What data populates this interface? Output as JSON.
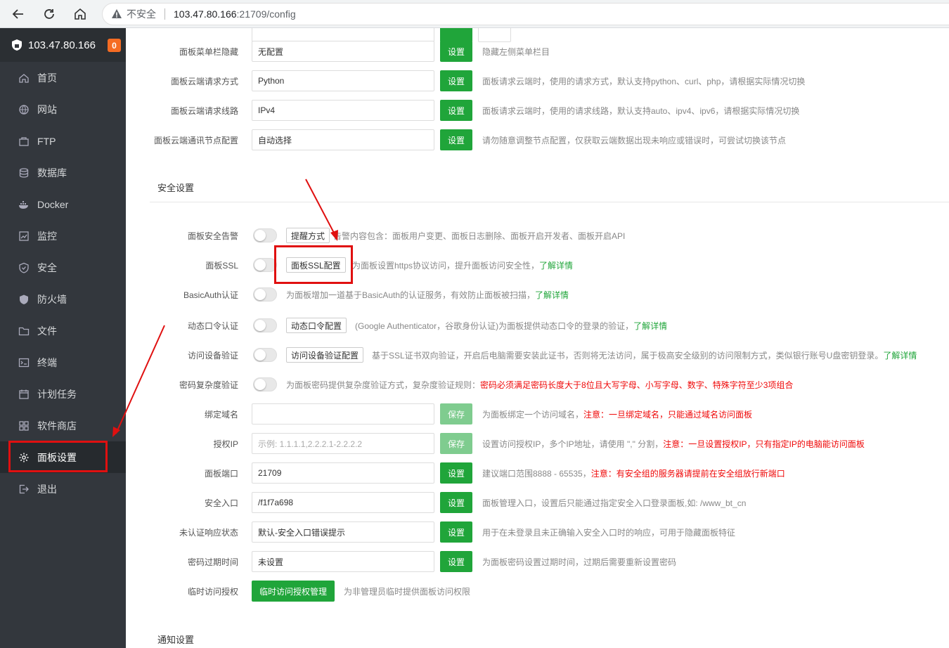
{
  "browser": {
    "security": "不安全",
    "url_host": "103.47.80.166",
    "url_path": ":21709/config"
  },
  "sidebar": {
    "server": "103.47.80.166",
    "badge": "0",
    "items": [
      {
        "label": "首页",
        "icon": "home-icon"
      },
      {
        "label": "网站",
        "icon": "globe-icon"
      },
      {
        "label": "FTP",
        "icon": "ftp-icon"
      },
      {
        "label": "数据库",
        "icon": "database-icon"
      },
      {
        "label": "Docker",
        "icon": "docker-icon"
      },
      {
        "label": "监控",
        "icon": "monitor-icon"
      },
      {
        "label": "安全",
        "icon": "shield-icon"
      },
      {
        "label": "防火墙",
        "icon": "firewall-icon"
      },
      {
        "label": "文件",
        "icon": "folder-icon"
      },
      {
        "label": "终端",
        "icon": "terminal-icon"
      },
      {
        "label": "计划任务",
        "icon": "calendar-icon"
      },
      {
        "label": "软件商店",
        "icon": "apps-icon"
      },
      {
        "label": "面板设置",
        "icon": "gear-icon"
      },
      {
        "label": "退出",
        "icon": "logout-icon"
      }
    ]
  },
  "panel": {
    "hide_menu": {
      "label": "面板菜单栏隐藏",
      "value": "无配置",
      "button": "设置",
      "hint": "隐藏左侧菜单栏目"
    },
    "cloud_method": {
      "label": "面板云端请求方式",
      "value": "Python",
      "button": "设置",
      "hint": "面板请求云端时，使用的请求方式，默认支持python、curl、php，请根据实际情况切换"
    },
    "cloud_line": {
      "label": "面板云端请求线路",
      "value": "IPv4",
      "button": "设置",
      "hint": "面板请求云端时，使用的请求线路，默认支持auto、ipv4、ipv6，请根据实际情况切换"
    },
    "cloud_node": {
      "label": "面板云端通讯节点配置",
      "value": "自动选择",
      "button": "设置",
      "hint": "请勿随意调整节点配置，仅获取云端数据出现未响应或错误时，可尝试切换该节点"
    }
  },
  "security": {
    "title": "安全设置",
    "alarm": {
      "label": "面板安全告警",
      "button": "提醒方式",
      "hint": "告警内容包含：面板用户变更、面板日志删除、面板开启开发者、面板开启API"
    },
    "ssl": {
      "label": "面板SSL",
      "button": "面板SSL配置",
      "hint": "为面板设置https协议访问，提升面板访问安全性，",
      "link": "了解详情"
    },
    "basicauth": {
      "label": "BasicAuth认证",
      "hint": "为面板增加一道基于BasicAuth的认证服务，有效防止面板被扫描，",
      "link": "了解详情"
    },
    "otp": {
      "label": "动态口令认证",
      "button": "动态口令配置",
      "hint": "(Google Authenticator，谷歌身份认证)为面板提供动态口令的登录的验证，",
      "link": "了解详情"
    },
    "device": {
      "label": "访问设备验证",
      "button": "访问设备验证配置",
      "hint": "基于SSL证书双向验证，开启后电脑需要安装此证书，否则将无法访问，属于极高安全级别的访问限制方式，类似银行账号U盘密钥登录。",
      "link": "了解详情"
    },
    "complexity": {
      "label": "密码复杂度验证",
      "hint": "为面板密码提供复杂度验证方式，复杂度验证规则：",
      "red": "密码必须满足密码长度大于8位且大写字母、小写字母、数字、特殊字符至少3项组合"
    },
    "domain": {
      "label": "绑定域名",
      "value": "",
      "button": "保存",
      "hint": "为面板绑定一个访问域名，",
      "red": "注意：一旦绑定域名，只能通过域名访问面板"
    },
    "auth_ip": {
      "label": "授权IP",
      "placeholder": "示例: 1.1.1.1,2.2.2.1-2.2.2.2",
      "button": "保存",
      "hint": "设置访问授权IP，多个IP地址，请使用 \",\" 分割，",
      "red": "注意：一旦设置授权IP，只有指定IP的电脑能访问面板"
    },
    "port": {
      "label": "面板端口",
      "value": "21709",
      "button": "设置",
      "hint": "建议端口范围8888 - 65535，",
      "red": "注意：有安全组的服务器请提前在安全组放行新端口"
    },
    "entry": {
      "label": "安全入口",
      "value": "/f1f7a698",
      "button": "设置",
      "hint": "面板管理入口，设置后只能通过指定安全入口登录面板,如: /www_bt_cn"
    },
    "unauth": {
      "label": "未认证响应状态",
      "value": "默认-安全入口错误提示",
      "button": "设置",
      "hint": "用于在未登录且未正确输入安全入口时的响应，可用于隐藏面板特征"
    },
    "expire": {
      "label": "密码过期时间",
      "value": "未设置",
      "button": "设置",
      "hint": "为面板密码设置过期时间，过期后需要重新设置密码"
    },
    "temp": {
      "label": "临时访问授权",
      "button": "临时访问授权管理",
      "hint": "为非管理员临时提供面板访问权限"
    }
  },
  "notify": {
    "title": "通知设置"
  },
  "colors": {
    "accent": "#20a53a",
    "sidebar": "#33373d",
    "annotation": "#e01010"
  }
}
